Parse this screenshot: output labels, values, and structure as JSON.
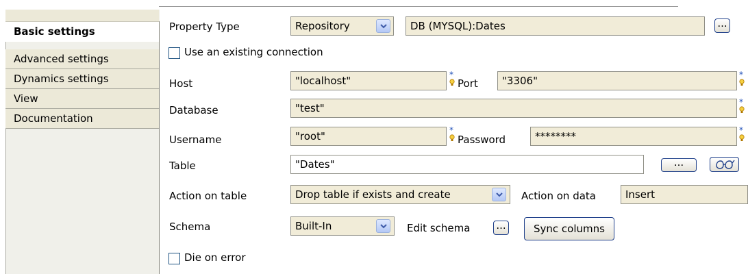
{
  "sidebar": {
    "items": [
      {
        "label": "Basic settings",
        "active": true
      },
      {
        "label": "Advanced settings"
      },
      {
        "label": "Dynamics settings"
      },
      {
        "label": "View"
      },
      {
        "label": "Documentation"
      }
    ]
  },
  "form": {
    "property_type": {
      "label": "Property Type",
      "selected": "Repository",
      "value": "DB (MYSQL):Dates"
    },
    "use_existing_connection": {
      "label": "Use an existing connection",
      "checked": false
    },
    "host": {
      "label": "Host",
      "value": "\"localhost\""
    },
    "port": {
      "label": "Port",
      "value": "\"3306\""
    },
    "database": {
      "label": "Database",
      "value": "\"test\""
    },
    "username": {
      "label": "Username",
      "value": "\"root\""
    },
    "password": {
      "label": "Password",
      "value": "********"
    },
    "table": {
      "label": "Table",
      "value": "\"Dates\""
    },
    "action_on_table": {
      "label": "Action on table",
      "selected": "Drop table if exists and create"
    },
    "action_on_data": {
      "label": "Action on data",
      "selected": "Insert"
    },
    "schema": {
      "label": "Schema",
      "selected": "Built-In",
      "edit_label": "Edit schema",
      "sync_label": "Sync columns"
    },
    "die_on_error": {
      "label": "Die on error",
      "checked": false
    },
    "ellipsis": "..."
  },
  "colors": {
    "field_bg": "#f1ecd8",
    "sidebar_bg": "#ece9d8",
    "button_border": "#1e3f8a",
    "required_star": "#1f4fb8",
    "bulb": "#e0a020"
  },
  "icons": {
    "required": "required-marker-icon",
    "dropdown": "chevron-down-icon",
    "view": "glasses-icon"
  }
}
